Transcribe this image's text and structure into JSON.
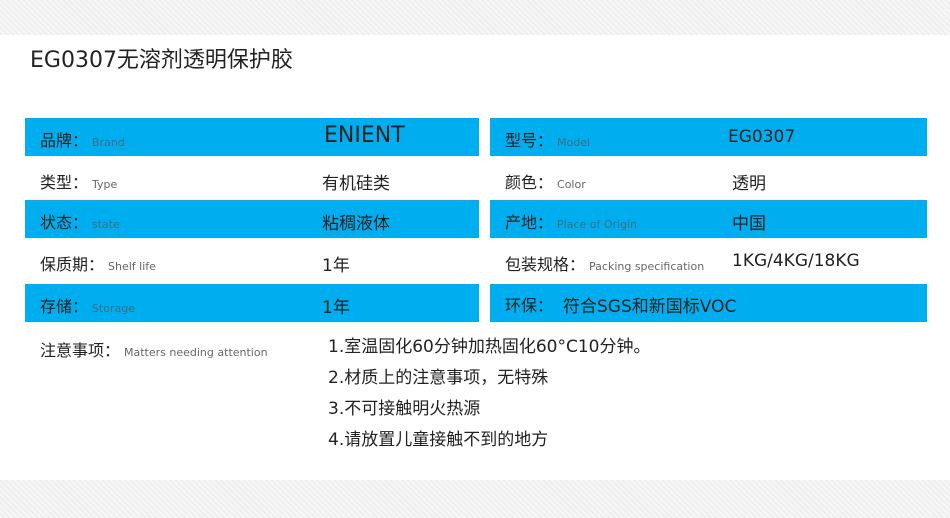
{
  "title": "EG0307无溶剂透明保护胶",
  "rows": [
    {
      "left": {
        "label": "品牌：",
        "label_en": "Brand",
        "value": "ENIENT"
      },
      "right": {
        "label": "型号：",
        "label_en": "Model",
        "value": "EG0307"
      }
    },
    {
      "left": {
        "label": "类型：",
        "label_en": "Type",
        "value": "有机硅类"
      },
      "right": {
        "label": "颜色：",
        "label_en": "Color",
        "value": "透明"
      }
    },
    {
      "left": {
        "label": "状态：",
        "label_en": "state",
        "value": "粘稠液体"
      },
      "right": {
        "label": "产地：",
        "label_en": "Place of Origin",
        "value": "中国"
      }
    },
    {
      "left": {
        "label": "保质期：",
        "label_en": "Shelf life",
        "value": "1年"
      },
      "right": {
        "label": "包装规格：",
        "label_en": "Packing specification",
        "value": "1KG/4KG/18KG"
      }
    },
    {
      "left": {
        "label": "存储：",
        "label_en": "Storage",
        "value": "1年"
      },
      "right": {
        "label": "环保：",
        "label_en": "",
        "value": "符合SGS和新国标VOC"
      }
    }
  ],
  "notes": {
    "label": "注意事项：",
    "label_en": "Matters needing attention",
    "items": [
      "1.室温固化60分钟加热固化60°C10分钟。",
      "2.材质上的注意事项，无特殊",
      "3.不可接触明火热源",
      "4.请放置儿童接触不到的地方"
    ]
  },
  "colors": {
    "band": "#00aeef",
    "text": "#222222"
  }
}
